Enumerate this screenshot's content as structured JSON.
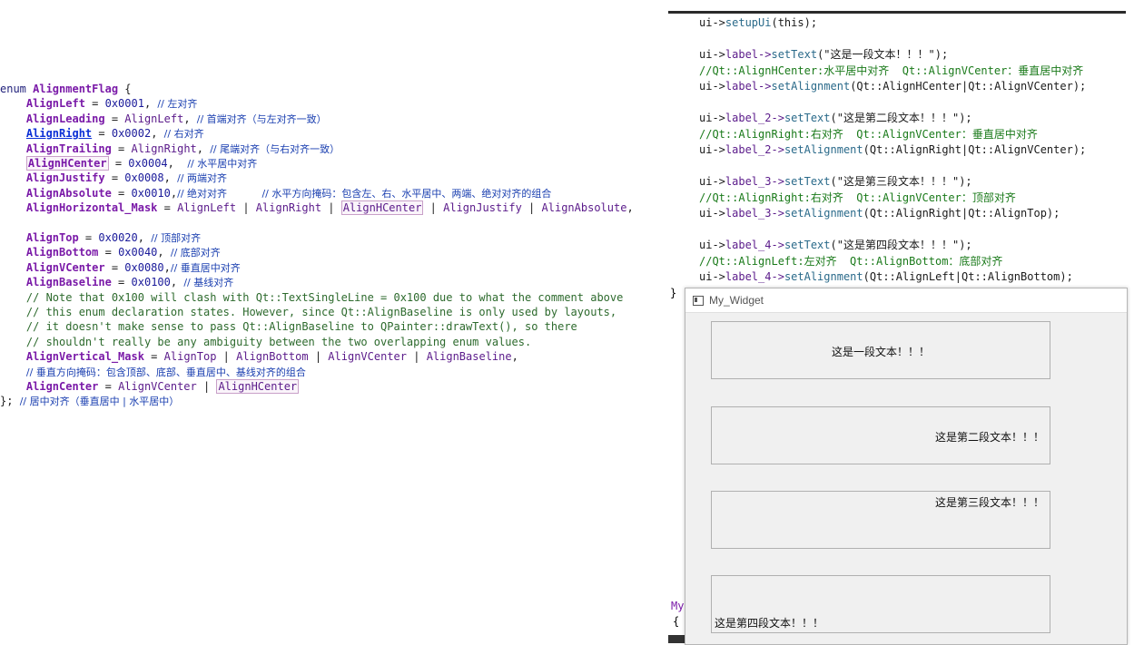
{
  "left_code": {
    "lines": [
      {
        "parts": [
          {
            "t": "enum ",
            "c": "kw"
          },
          {
            "t": "AlignmentFlag",
            "c": "id"
          },
          {
            "t": " {",
            "c": "op"
          }
        ]
      },
      {
        "parts": [
          {
            "t": "    AlignLeft",
            "c": "id"
          },
          {
            "t": " = ",
            "c": "op"
          },
          {
            "t": "0x0001",
            "c": "num"
          },
          {
            "t": ", ",
            "c": "op"
          },
          {
            "t": "// 左对齐",
            "c": "cn"
          }
        ]
      },
      {
        "parts": [
          {
            "t": "    AlignLeading",
            "c": "id"
          },
          {
            "t": " = ",
            "c": "op"
          },
          {
            "t": "AlignLeft",
            "c": "id2"
          },
          {
            "t": ", ",
            "c": "op"
          },
          {
            "t": "// 首端对齐（与左对齐一致）",
            "c": "cn"
          }
        ]
      },
      {
        "parts": [
          {
            "t": "    ",
            "c": "op"
          },
          {
            "t": "AlignRight",
            "c": "link"
          },
          {
            "t": " = ",
            "c": "op"
          },
          {
            "t": "0x0002",
            "c": "num"
          },
          {
            "t": ", ",
            "c": "op"
          },
          {
            "t": "// 右对齐",
            "c": "cn"
          }
        ]
      },
      {
        "parts": [
          {
            "t": "    AlignTrailing",
            "c": "id"
          },
          {
            "t": " = ",
            "c": "op"
          },
          {
            "t": "AlignRight",
            "c": "id2"
          },
          {
            "t": ", ",
            "c": "op"
          },
          {
            "t": "// 尾端对齐（与右对齐一致）",
            "c": "cn"
          }
        ]
      },
      {
        "parts": [
          {
            "t": "    ",
            "c": "op"
          },
          {
            "t": "AlignHCenter",
            "c": "id box"
          },
          {
            "t": " = ",
            "c": "op"
          },
          {
            "t": "0x0004",
            "c": "num"
          },
          {
            "t": ",  ",
            "c": "op"
          },
          {
            "t": "// 水平居中对齐",
            "c": "cn"
          }
        ]
      },
      {
        "parts": [
          {
            "t": "    AlignJustify",
            "c": "id"
          },
          {
            "t": " = ",
            "c": "op"
          },
          {
            "t": "0x0008",
            "c": "num"
          },
          {
            "t": ", ",
            "c": "op"
          },
          {
            "t": "// 两端对齐",
            "c": "cn"
          }
        ]
      },
      {
        "parts": [
          {
            "t": "    AlignAbsolute",
            "c": "id"
          },
          {
            "t": " = ",
            "c": "op"
          },
          {
            "t": "0x0010",
            "c": "num"
          },
          {
            "t": ",",
            "c": "op"
          },
          {
            "t": "// 绝对对齐           // 水平方向掩码：包含左、右、水平居中、两端、绝对对齐的组合",
            "c": "cn"
          }
        ]
      },
      {
        "parts": [
          {
            "t": "    AlignHorizontal_Mask",
            "c": "id"
          },
          {
            "t": " = ",
            "c": "op"
          },
          {
            "t": "AlignLeft",
            "c": "id2"
          },
          {
            "t": " | ",
            "c": "op"
          },
          {
            "t": "AlignRight",
            "c": "id2"
          },
          {
            "t": " | ",
            "c": "op"
          },
          {
            "t": "AlignHCenter",
            "c": "id2 box"
          },
          {
            "t": " | ",
            "c": "op"
          },
          {
            "t": "AlignJustify",
            "c": "id2"
          },
          {
            "t": " | ",
            "c": "op"
          },
          {
            "t": "AlignAbsolute",
            "c": "id2"
          },
          {
            "t": ",",
            "c": "op"
          }
        ]
      },
      {
        "parts": []
      },
      {
        "parts": [
          {
            "t": "    AlignTop",
            "c": "id"
          },
          {
            "t": " = ",
            "c": "op"
          },
          {
            "t": "0x0020",
            "c": "num"
          },
          {
            "t": ", ",
            "c": "op"
          },
          {
            "t": "// 顶部对齐",
            "c": "cn"
          }
        ]
      },
      {
        "parts": [
          {
            "t": "    AlignBottom",
            "c": "id"
          },
          {
            "t": " = ",
            "c": "op"
          },
          {
            "t": "0x0040",
            "c": "num"
          },
          {
            "t": ", ",
            "c": "op"
          },
          {
            "t": "// 底部对齐",
            "c": "cn"
          }
        ]
      },
      {
        "parts": [
          {
            "t": "    AlignVCenter",
            "c": "id"
          },
          {
            "t": " = ",
            "c": "op"
          },
          {
            "t": "0x0080",
            "c": "num"
          },
          {
            "t": ",",
            "c": "op"
          },
          {
            "t": "// 垂直居中对齐",
            "c": "cn"
          }
        ]
      },
      {
        "parts": [
          {
            "t": "    AlignBaseline",
            "c": "id"
          },
          {
            "t": " = ",
            "c": "op"
          },
          {
            "t": "0x0100",
            "c": "num"
          },
          {
            "t": ", ",
            "c": "op"
          },
          {
            "t": "// 基线对齐",
            "c": "cn"
          }
        ]
      },
      {
        "parts": [
          {
            "t": "    // Note that 0x100 will clash with Qt::TextSingleLine = 0x100 due to what the comment above",
            "c": "cmt"
          }
        ]
      },
      {
        "parts": [
          {
            "t": "    // this enum declaration states. However, since Qt::AlignBaseline is only used by layouts,",
            "c": "cmt"
          }
        ]
      },
      {
        "parts": [
          {
            "t": "    // it doesn't make sense to pass Qt::AlignBaseline to QPainter::drawText(), so there",
            "c": "cmt"
          }
        ]
      },
      {
        "parts": [
          {
            "t": "    // shouldn't really be any ambiguity between the two overlapping enum values.",
            "c": "cmt"
          }
        ]
      },
      {
        "parts": [
          {
            "t": "    AlignVertical_Mask",
            "c": "id"
          },
          {
            "t": " = ",
            "c": "op"
          },
          {
            "t": "AlignTop",
            "c": "id2"
          },
          {
            "t": " | ",
            "c": "op"
          },
          {
            "t": "AlignBottom",
            "c": "id2"
          },
          {
            "t": " | ",
            "c": "op"
          },
          {
            "t": "AlignVCenter",
            "c": "id2"
          },
          {
            "t": " | ",
            "c": "op"
          },
          {
            "t": "AlignBaseline",
            "c": "id2"
          },
          {
            "t": ",",
            "c": "op"
          }
        ]
      },
      {
        "parts": [
          {
            "t": "    ",
            "c": "op"
          },
          {
            "t": "// 垂直方向掩码：包含顶部、底部、垂直居中、基线对齐的组合",
            "c": "cn"
          }
        ]
      },
      {
        "parts": [
          {
            "t": "    AlignCenter",
            "c": "id"
          },
          {
            "t": " = ",
            "c": "op"
          },
          {
            "t": "AlignVCenter",
            "c": "id2"
          },
          {
            "t": " | ",
            "c": "op"
          },
          {
            "t": "AlignHCenter",
            "c": "id2 box"
          }
        ]
      },
      {
        "parts": [
          {
            "t": "}; ",
            "c": "op"
          },
          {
            "t": "// 居中对齐（垂直居中 | 水平居中）",
            "c": "cn"
          }
        ]
      }
    ]
  },
  "right_code": {
    "lines": [
      {
        "parts": [
          {
            "t": "ui->",
            "c": "s"
          },
          {
            "t": "setupUi",
            "c": "f"
          },
          {
            "t": "(this);",
            "c": "s"
          }
        ]
      },
      {
        "parts": []
      },
      {
        "parts": [
          {
            "t": "ui->",
            "c": "s"
          },
          {
            "t": "label->",
            "c": "id2"
          },
          {
            "t": "setText",
            "c": "f"
          },
          {
            "t": "(\"这是一段文本！！！\");",
            "c": "s"
          }
        ]
      },
      {
        "parts": [
          {
            "t": "//Qt::AlignHCenter:水平居中对齐  Qt::AlignVCenter：垂直居中对齐",
            "c": "g"
          }
        ]
      },
      {
        "parts": [
          {
            "t": "ui->",
            "c": "s"
          },
          {
            "t": "label->",
            "c": "id2"
          },
          {
            "t": "setAlignment",
            "c": "f"
          },
          {
            "t": "(Qt::AlignHCenter|Qt::AlignVCenter);",
            "c": "s"
          }
        ]
      },
      {
        "parts": []
      },
      {
        "parts": [
          {
            "t": "ui->",
            "c": "s"
          },
          {
            "t": "label_2->",
            "c": "id2"
          },
          {
            "t": "setText",
            "c": "f"
          },
          {
            "t": "(\"这是第二段文本！！！\");",
            "c": "s"
          }
        ]
      },
      {
        "parts": [
          {
            "t": "//Qt::AlignRight:右对齐  Qt::AlignVCenter：垂直居中对齐",
            "c": "g"
          }
        ]
      },
      {
        "parts": [
          {
            "t": "ui->",
            "c": "s"
          },
          {
            "t": "label_2->",
            "c": "id2"
          },
          {
            "t": "setAlignment",
            "c": "f"
          },
          {
            "t": "(Qt::AlignRight|Qt::AlignVCenter);",
            "c": "s"
          }
        ]
      },
      {
        "parts": []
      },
      {
        "parts": [
          {
            "t": "ui->",
            "c": "s"
          },
          {
            "t": "label_3->",
            "c": "id2"
          },
          {
            "t": "setText",
            "c": "f"
          },
          {
            "t": "(\"这是第三段文本！！！\");",
            "c": "s"
          }
        ]
      },
      {
        "parts": [
          {
            "t": "//Qt::AlignRight:右对齐  Qt::AlignVCenter：顶部对齐",
            "c": "g"
          }
        ]
      },
      {
        "parts": [
          {
            "t": "ui->",
            "c": "s"
          },
          {
            "t": "label_3->",
            "c": "id2"
          },
          {
            "t": "setAlignment",
            "c": "f"
          },
          {
            "t": "(Qt::AlignRight|Qt::AlignTop);",
            "c": "s"
          }
        ]
      },
      {
        "parts": []
      },
      {
        "parts": [
          {
            "t": "ui->",
            "c": "s"
          },
          {
            "t": "label_4->",
            "c": "id2"
          },
          {
            "t": "setText",
            "c": "f"
          },
          {
            "t": "(\"这是第四段文本！！！\");",
            "c": "s"
          }
        ]
      },
      {
        "parts": [
          {
            "t": "//Qt::AlignLeft:左对齐  Qt::AlignBottom：底部对齐",
            "c": "g"
          }
        ]
      },
      {
        "parts": [
          {
            "t": "ui->",
            "c": "s"
          },
          {
            "t": "label_4->",
            "c": "id2"
          },
          {
            "t": "setAlignment",
            "c": "f"
          },
          {
            "t": "(Qt::AlignLeft|Qt::AlignBottom);",
            "c": "s"
          }
        ]
      }
    ],
    "closing_brace": "}",
    "my_prefix": "My",
    "open_brace": "{"
  },
  "window": {
    "title": "My_Widget",
    "labels": [
      {
        "text": "这是一段文本！！！",
        "align": "center-vcenter"
      },
      {
        "text": "这是第二段文本！！！",
        "align": "right-vcenter"
      },
      {
        "text": "这是第三段文本！！！",
        "align": "right-top"
      },
      {
        "text": "这是第四段文本！！！",
        "align": "left-bottom"
      }
    ]
  }
}
